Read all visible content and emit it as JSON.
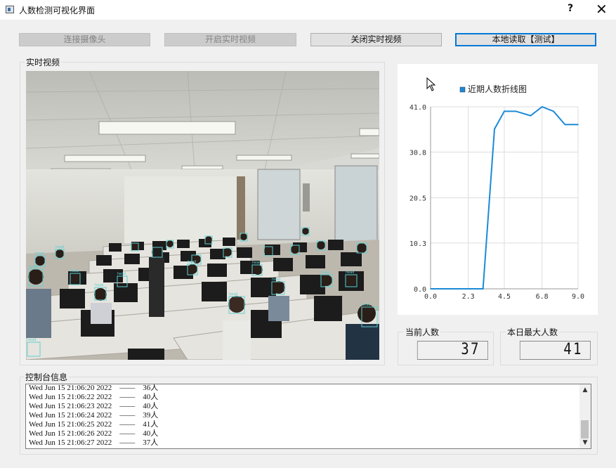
{
  "window": {
    "title": "人数检测可视化界面",
    "help_label": "?",
    "close_label": "✕"
  },
  "toolbar": {
    "connect_camera": "连接摄像头",
    "start_video": "开启实时视频",
    "stop_video": "关闭实时视频",
    "local_read": "本地读取【测试】"
  },
  "video_panel": {
    "label": "实时视频",
    "detection_label": "head"
  },
  "chart_data": {
    "type": "line",
    "title": "",
    "legend": "近期人数折线图",
    "legend_position": "top",
    "x": [
      0.0,
      2.3,
      3.2,
      3.9,
      4.5,
      5.2,
      6.1,
      6.8,
      7.5,
      8.2,
      9.0
    ],
    "y": [
      0,
      0,
      0,
      36,
      40,
      40,
      39,
      41,
      40,
      37,
      37
    ],
    "series": [
      {
        "values": [
          0,
          0,
          36,
          40,
          40,
          39,
          41,
          40,
          37
        ]
      }
    ],
    "x_ticks": [
      "0.0",
      "2.3",
      "4.5",
      "6.8",
      "9.0"
    ],
    "y_ticks": [
      "0.0",
      "10.3",
      "20.5",
      "30.8",
      "41.0"
    ],
    "xlim": [
      0,
      9
    ],
    "ylim": [
      0,
      41
    ],
    "grid": true,
    "line_color": "#1b8ad8"
  },
  "counters": {
    "current_label": "当前人数",
    "current_value": "37",
    "max_label": "本日最大人数",
    "max_value": "41"
  },
  "console": {
    "label": "控制台信息",
    "lines": [
      {
        "time": "Wed Jun 15 21:06:20 2022",
        "sep": "——",
        "count": "36人"
      },
      {
        "time": "Wed Jun 15 21:06:22 2022",
        "sep": "——",
        "count": "40人"
      },
      {
        "time": "Wed Jun 15 21:06:23 2022",
        "sep": "——",
        "count": "40人"
      },
      {
        "time": "Wed Jun 15 21:06:24 2022",
        "sep": "——",
        "count": "39人"
      },
      {
        "time": "Wed Jun 15 21:06:25 2022",
        "sep": "——",
        "count": "41人"
      },
      {
        "time": "Wed Jun 15 21:06:26 2022",
        "sep": "——",
        "count": "40人"
      },
      {
        "time": "Wed Jun 15 21:06:27 2022",
        "sep": "——",
        "count": "37人"
      }
    ]
  },
  "colors": {
    "accent": "#0078d7",
    "chart_line": "#1b8ad8",
    "detection_box": "#5fd0d0"
  }
}
